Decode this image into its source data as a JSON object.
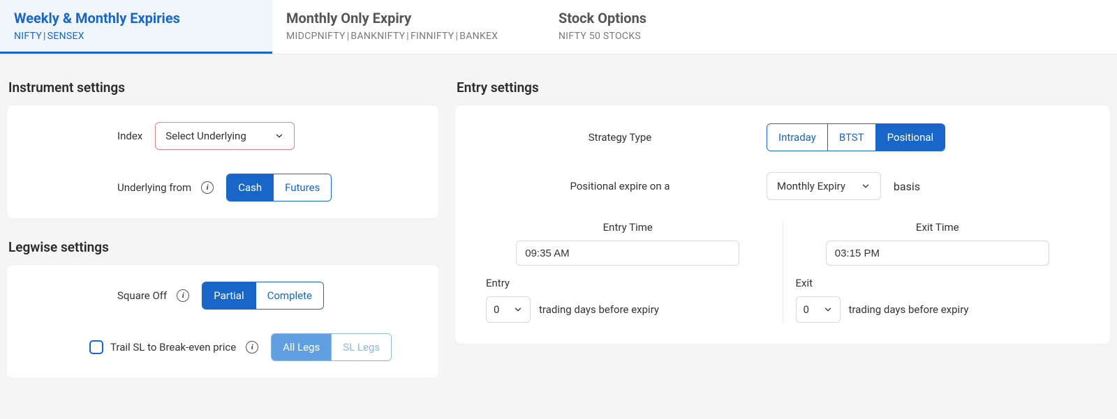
{
  "tabs": [
    {
      "title": "Weekly & Monthly Expiries",
      "sub": [
        "NIFTY",
        "SENSEX"
      ],
      "active": true
    },
    {
      "title": "Monthly Only Expiry",
      "sub": [
        "MIDCPNIFTY",
        "BANKNIFTY",
        "FINNIFTY",
        "BANKEX"
      ],
      "active": false
    },
    {
      "title": "Stock Options",
      "sub": [
        "NIFTY 50 STOCKS"
      ],
      "active": false
    }
  ],
  "instrument": {
    "section_title": "Instrument settings",
    "index_label": "Index",
    "index_placeholder": "Select Underlying",
    "underlying_from_label": "Underlying from",
    "underlying_opts": [
      "Cash",
      "Futures"
    ],
    "underlying_selected": "Cash"
  },
  "legwise": {
    "section_title": "Legwise settings",
    "square_off_label": "Square Off",
    "square_off_opts": [
      "Partial",
      "Complete"
    ],
    "square_off_selected": "Partial",
    "trail_label": "Trail SL to Break-even price",
    "trail_checked": false,
    "legs_opts": [
      "All Legs",
      "SL Legs"
    ],
    "legs_selected": "All Legs"
  },
  "entry": {
    "section_title": "Entry settings",
    "strategy_type_label": "Strategy Type",
    "strategy_opts": [
      "Intraday",
      "BTST",
      "Positional"
    ],
    "strategy_selected": "Positional",
    "positional_prefix": "Positional expire on a",
    "positional_expiry": "Monthly Expiry",
    "positional_suffix": "basis",
    "entry_time_label": "Entry Time",
    "entry_time": "09:35 AM",
    "entry_sub": "Entry",
    "entry_days": "0",
    "exit_time_label": "Exit Time",
    "exit_time": "03:15 PM",
    "exit_sub": "Exit",
    "exit_days": "0",
    "days_suffix": "trading days before expiry"
  }
}
